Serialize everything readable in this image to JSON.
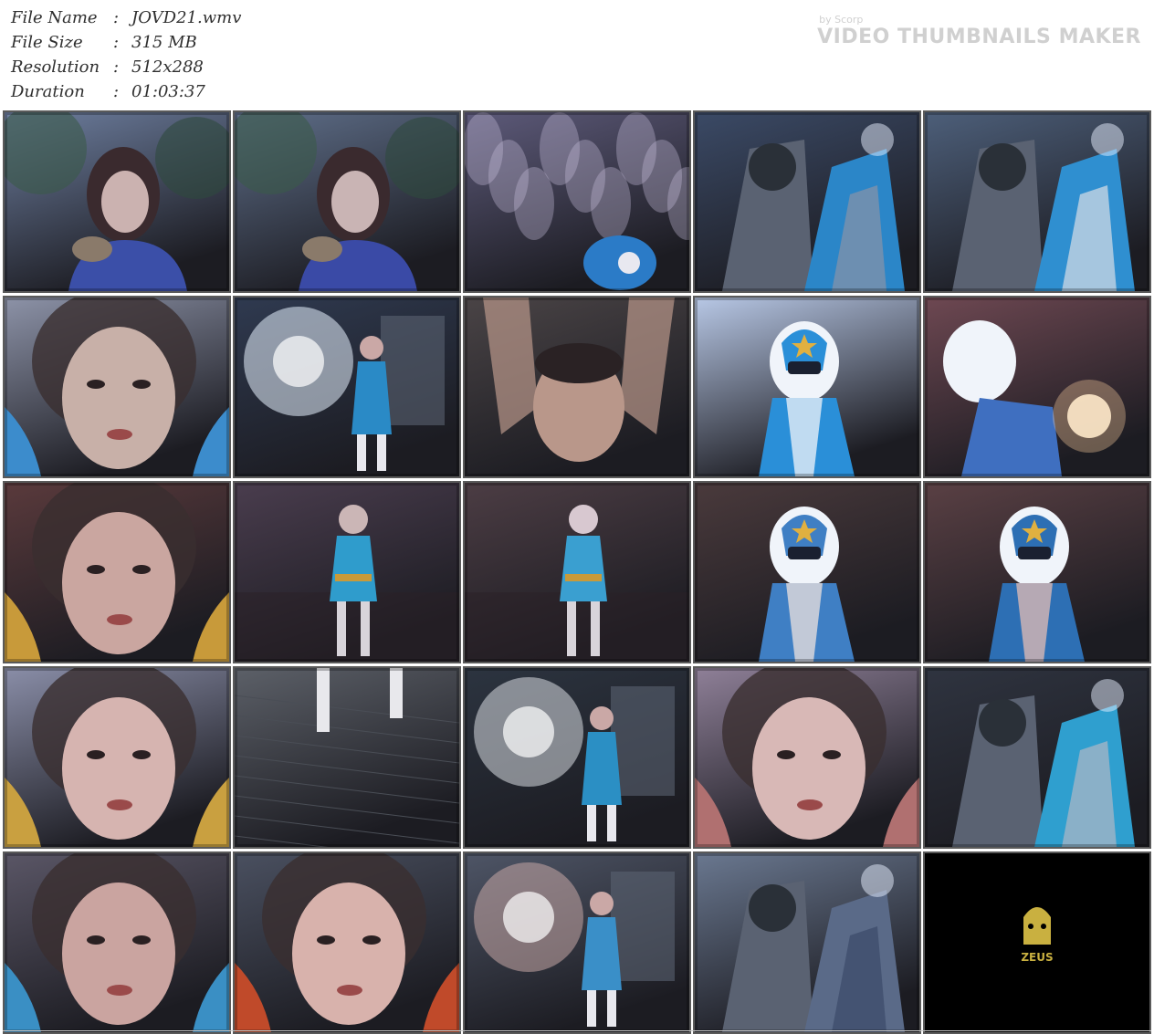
{
  "info": {
    "rows": [
      {
        "label": "File Name",
        "sep": ":",
        "value": "JOVD21.wmv"
      },
      {
        "label": "File Size",
        "sep": ":",
        "value": "315 MB"
      },
      {
        "label": "Resolution",
        "sep": ":",
        "value": "512x288"
      },
      {
        "label": "Duration",
        "sep": ":",
        "value": "01:03:37"
      }
    ]
  },
  "watermark": {
    "by": "by Scorp",
    "title": "VIDEO THUMBNAILS MAKER"
  },
  "thumbnails": [
    {
      "scene": "woman-in-forest",
      "bg": "#6e7fa0",
      "accent": "#3b4fa8",
      "skin": "#cbb2b0"
    },
    {
      "scene": "woman-in-forest",
      "bg": "#5f6f8a",
      "accent": "#3a4aa6",
      "skin": "#c9b4b4"
    },
    {
      "scene": "trees-motion",
      "bg": "#5d5a7a",
      "accent": "#2b7bc7",
      "skin": "#a89cc0"
    },
    {
      "scene": "armored-fight",
      "bg": "#3b4a66",
      "accent": "#2b86c8",
      "skin": "#8a93a6"
    },
    {
      "scene": "armored-fight",
      "bg": "#4d5f7a",
      "accent": "#2f8fd0",
      "skin": "#d8dde6"
    },
    {
      "scene": "face-closeup",
      "bg": "#8d93a8",
      "accent": "#3c8ccc",
      "skin": "#c8b0a8"
    },
    {
      "scene": "heroine-light",
      "bg": "#2f3a50",
      "accent": "#2a8ac6",
      "skin": "#e8f2ff"
    },
    {
      "scene": "man-closeup",
      "bg": "#4a4446",
      "accent": "#6b5f5a",
      "skin": "#b9978a"
    },
    {
      "scene": "helmet-hero",
      "bg": "#b8c8e6",
      "accent": "#2a8fd8",
      "skin": "#e6eef8"
    },
    {
      "scene": "spark-fight",
      "bg": "#6e4852",
      "accent": "#3f6fc0",
      "skin": "#f0e6e0"
    },
    {
      "scene": "face-closeup",
      "bg": "#5a3a3c",
      "accent": "#c89a3a",
      "skin": "#caa6a0"
    },
    {
      "scene": "heroine-standing",
      "bg": "#4a3d4e",
      "accent": "#2f9ccc",
      "skin": "#cbb6b6"
    },
    {
      "scene": "heroine-standing",
      "bg": "#4c3d44",
      "accent": "#3a9fd0",
      "skin": "#d8c8d0"
    },
    {
      "scene": "helmet-hero",
      "bg": "#4a3a3c",
      "accent": "#3f7fc4",
      "skin": "#e4dcdc"
    },
    {
      "scene": "helmet-hero",
      "bg": "#5a4044",
      "accent": "#2d6fb4",
      "skin": "#d8b8b4"
    },
    {
      "scene": "face-closeup",
      "bg": "#8a8ea8",
      "accent": "#c9a040",
      "skin": "#d6b4b0"
    },
    {
      "scene": "floor-boots",
      "bg": "#5c6068",
      "accent": "#e8e8ec",
      "skin": "#8a8e96"
    },
    {
      "scene": "heroine-light",
      "bg": "#2c3440",
      "accent": "#2b8fc4",
      "skin": "#d8dce2"
    },
    {
      "scene": "face-closeup",
      "bg": "#8f8098",
      "accent": "#b07070",
      "skin": "#d8b8b6"
    },
    {
      "scene": "armored-fight",
      "bg": "#2f3440",
      "accent": "#2f9fcf",
      "skin": "#b0b8c4"
    },
    {
      "scene": "face-closeup",
      "bg": "#5a5666",
      "accent": "#3a8fc4",
      "skin": "#caa4a0"
    },
    {
      "scene": "face-closeup",
      "bg": "#4a5060",
      "accent": "#c04a2a",
      "skin": "#d8b2ac"
    },
    {
      "scene": "heroine-light",
      "bg": "#4e5566",
      "accent": "#3a8fc8",
      "skin": "#c6a8a6"
    },
    {
      "scene": "armored-fight",
      "bg": "#6a7890",
      "accent": "#5a6a88",
      "skin": "#3a4a6a"
    },
    {
      "scene": "logo-card",
      "bg": "#000000",
      "accent": "#c9b040",
      "skin": "#7a6a20",
      "logo_text": "ZEUS"
    }
  ]
}
